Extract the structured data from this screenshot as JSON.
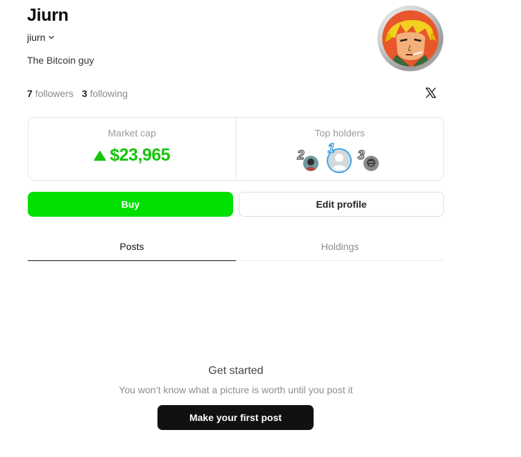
{
  "profile": {
    "name": "Jiurn",
    "handle": "jiurn",
    "bio": "The Bitcoin guy",
    "followers_count": "7",
    "followers_label": "followers",
    "following_count": "3",
    "following_label": "following"
  },
  "stats": {
    "market_cap_label": "Market cap",
    "market_cap_value": "$23,965",
    "market_cap_trend": "up",
    "top_holders_label": "Top holders",
    "top_holders": [
      {
        "rank": "2"
      },
      {
        "rank": "1"
      },
      {
        "rank": "3"
      }
    ]
  },
  "actions": {
    "buy_label": "Buy",
    "edit_label": "Edit profile"
  },
  "tabs": [
    {
      "label": "Posts",
      "active": true
    },
    {
      "label": "Holdings",
      "active": false
    }
  ],
  "empty_state": {
    "title": "Get started",
    "subtitle": "You won’t know what a picture is worth until you post it",
    "cta_label": "Make your first post"
  },
  "icons": {
    "social": "x-logo-icon",
    "handle_dropdown": "chevron-down-icon",
    "trend": "triangle-up-icon"
  },
  "colors": {
    "accent_green": "#00e000",
    "market_cap_green": "#16c40a",
    "dark_button": "#111111"
  }
}
